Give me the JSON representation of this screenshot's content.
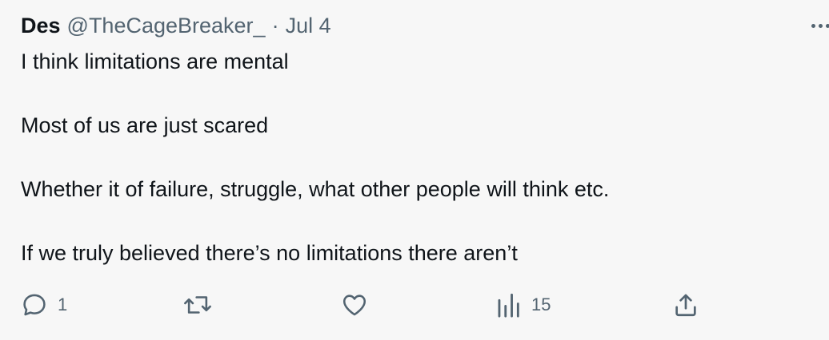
{
  "author": {
    "display_name": "Des",
    "handle": "@TheCageBreaker_",
    "separator": "·",
    "date": "Jul 4"
  },
  "tweet": {
    "paragraphs": [
      "I think limitations are mental",
      "Most of us are just scared",
      "Whether it of failure, struggle, what other people will think etc.",
      "If we truly believed there’s no limitations there aren’t"
    ]
  },
  "actions": {
    "reply_count": "1",
    "retweet_count": "",
    "like_count": "",
    "views_count": "15"
  },
  "icons": {
    "reply": "reply-icon",
    "retweet": "retweet-icon",
    "like": "heart-icon",
    "views": "views-chart-icon",
    "share": "share-icon",
    "more": "more-options-icon"
  },
  "colors": {
    "background": "#f7f7f7",
    "text": "#0f1419",
    "secondary": "#536471"
  }
}
